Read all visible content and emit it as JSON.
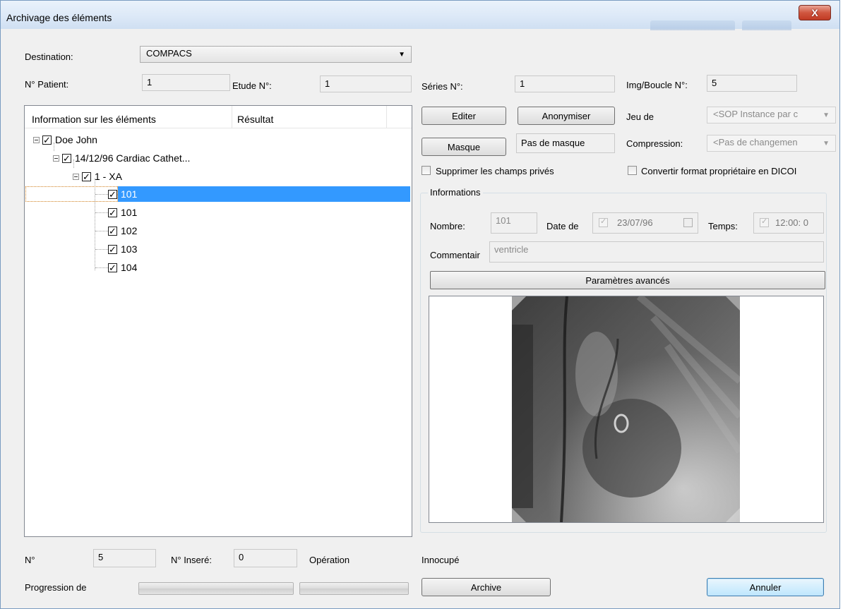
{
  "window": {
    "title": "Archivage des éléments",
    "close_glyph": "X"
  },
  "destination": {
    "label": "Destination:",
    "value": "COMPACS"
  },
  "ids": {
    "patient_label": "N° Patient:",
    "patient_value": "1",
    "etude_label": "Etude N°:",
    "etude_value": "1",
    "series_label": "Séries N°:",
    "series_value": "1",
    "img_label": "Img/Boucle N°:",
    "img_value": "5"
  },
  "tree": {
    "col_info": "Information sur les éléments",
    "col_result": "Résultat",
    "items": [
      {
        "label": "Doe John",
        "level": 0,
        "checked": true,
        "expanded": true
      },
      {
        "label": "14/12/96 Cardiac Cathet...",
        "level": 1,
        "checked": true,
        "expanded": true
      },
      {
        "label": "1 - XA",
        "level": 2,
        "checked": true,
        "expanded": true
      },
      {
        "label": "101",
        "level": 3,
        "checked": true,
        "selected": true
      },
      {
        "label": "101",
        "level": 3,
        "checked": true
      },
      {
        "label": "102",
        "level": 3,
        "checked": true
      },
      {
        "label": "103",
        "level": 3,
        "checked": true
      },
      {
        "label": "104",
        "level": 3,
        "checked": true
      }
    ]
  },
  "actions": {
    "editer": "Editer",
    "anonymiser": "Anonymiser",
    "masque": "Masque",
    "mask_status": "Pas de masque",
    "jeu_label": "Jeu de",
    "jeu_value": "<SOP Instance par c",
    "compression_label": "Compression:",
    "compression_value": "<Pas de changemen",
    "supprimer_label": "Supprimer les champs privés",
    "convertir_label": "Convertir format propriétaire en DICOI"
  },
  "informations": {
    "title": "Informations",
    "nombre_label": "Nombre:",
    "nombre_value": "101",
    "date_label": "Date de",
    "date_value": "23/07/96",
    "temps_label": "Temps:",
    "temps_value": "12:00: 0",
    "commentaire_label": "Commentair",
    "commentaire_value": "ventricle",
    "advanced_button": "Paramètres avancés"
  },
  "footer": {
    "n_label": "N°",
    "n_value": "5",
    "n_insere_label": "N° Inseré:",
    "n_insere_value": "0",
    "operation_label": "Opération",
    "status": "Innocupé",
    "progress_label": "Progression de",
    "progress_1": 0,
    "progress_2": 0,
    "archive_button": "Archive",
    "annuler_button": "Annuler"
  },
  "colors": {
    "selection": "#3399ff",
    "window_bg": "#f0f0f0",
    "close_button": "#c13b24"
  },
  "icons": [
    "close-icon",
    "dropdown-arrow-icon",
    "tree-collapse-icon",
    "checkbox-icon",
    "xray-image"
  ]
}
